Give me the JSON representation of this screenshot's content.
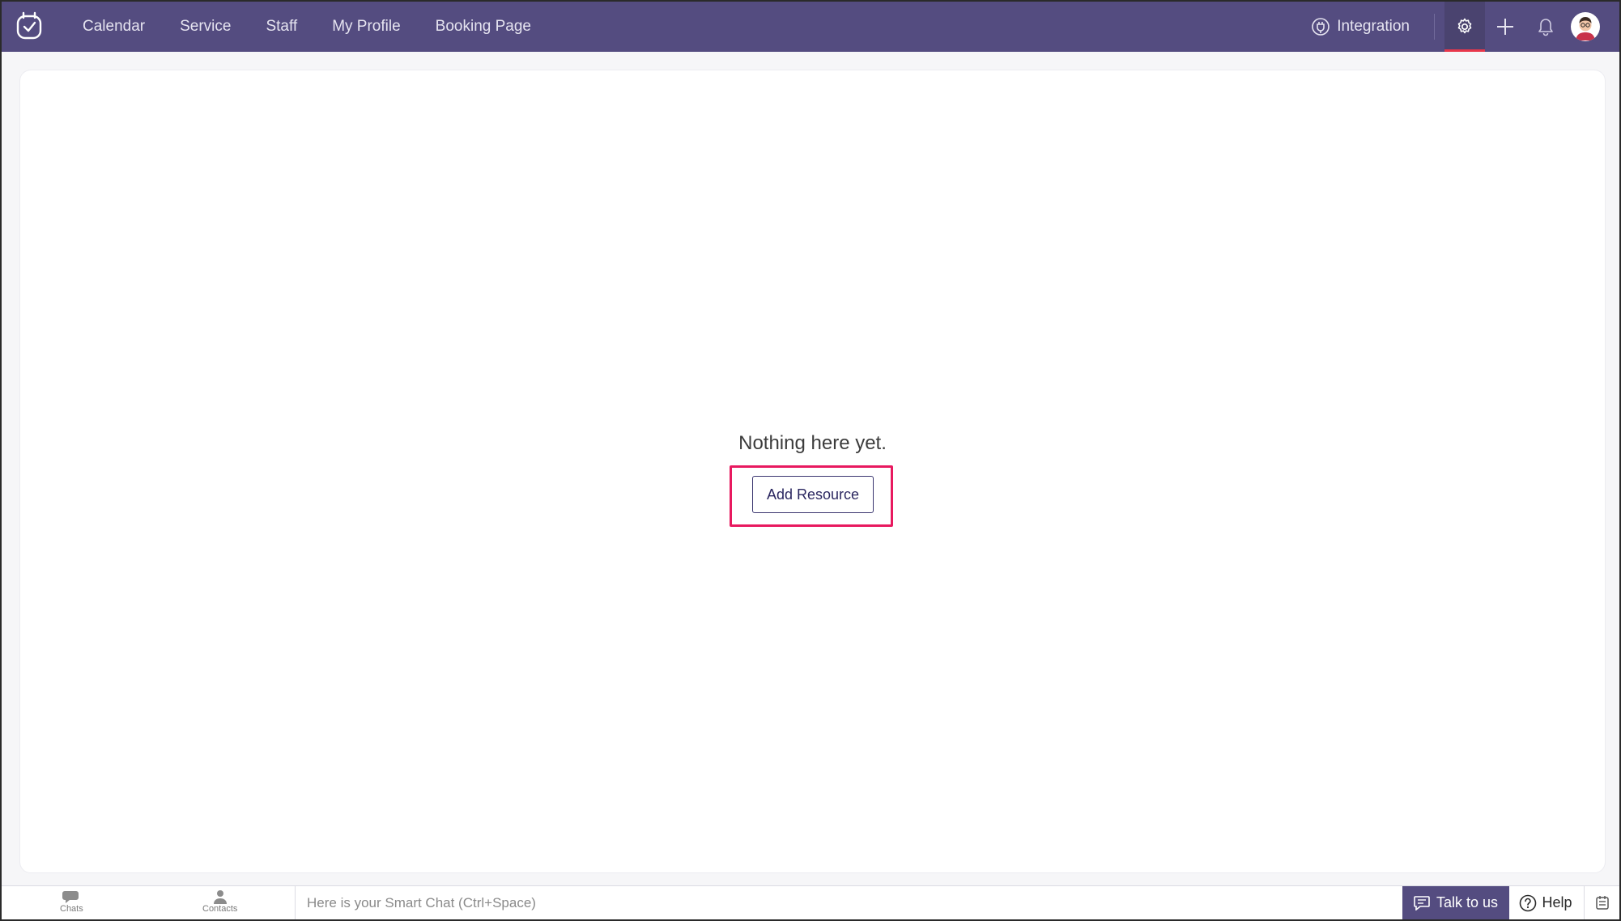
{
  "colors": {
    "topbar": "#544c80",
    "accent_underline": "#e8374b",
    "highlight_border": "#e8195f",
    "button_text": "#2b2760"
  },
  "nav": {
    "items": [
      {
        "label": "Calendar"
      },
      {
        "label": "Service"
      },
      {
        "label": "Staff"
      },
      {
        "label": "My Profile"
      },
      {
        "label": "Booking Page"
      }
    ]
  },
  "header": {
    "integration_label": "Integration",
    "icons": [
      "logo-icon",
      "integration-icon",
      "gear-icon",
      "plus-icon",
      "bell-icon",
      "avatar"
    ]
  },
  "main": {
    "empty_message": "Nothing here yet.",
    "add_button_label": "Add Resource"
  },
  "bottombar": {
    "chats_label": "Chats",
    "contacts_label": "Contacts",
    "smartchat_placeholder": "Here is your Smart Chat (Ctrl+Space)",
    "talk_label": "Talk to us",
    "help_label": "Help"
  }
}
